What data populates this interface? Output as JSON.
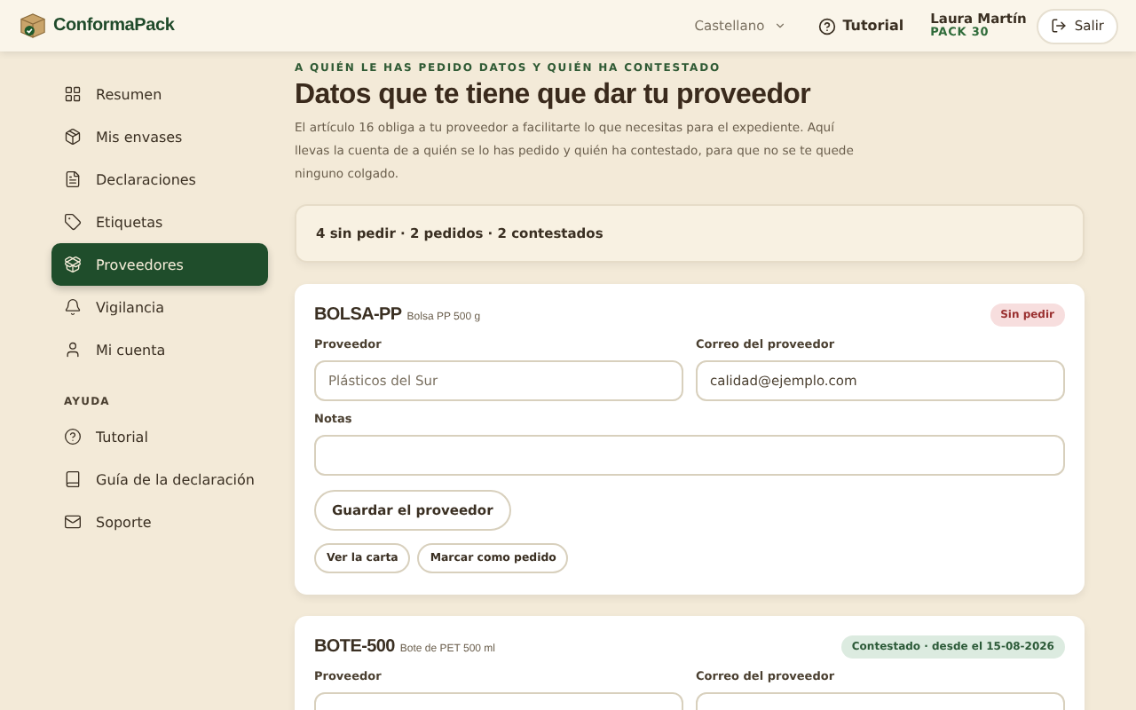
{
  "header": {
    "brand": "ConformaPack",
    "language": "Castellano",
    "tutorial": "Tutorial",
    "user": {
      "name": "Laura Martín",
      "plan": "PACK 30"
    },
    "logout": "Salir"
  },
  "sidebar": {
    "items": [
      {
        "label": "Resumen",
        "selected": false
      },
      {
        "label": "Mis envases",
        "selected": false
      },
      {
        "label": "Declaraciones",
        "selected": false
      },
      {
        "label": "Etiquetas",
        "selected": false
      },
      {
        "label": "Proveedores",
        "selected": true
      },
      {
        "label": "Vigilancia",
        "selected": false
      },
      {
        "label": "Mi cuenta",
        "selected": false
      }
    ],
    "section": "AYUDA",
    "help_items": [
      {
        "label": "Tutorial",
        "selected": false
      },
      {
        "label": "Guía de la declaración",
        "selected": false
      },
      {
        "label": "Soporte",
        "selected": false
      }
    ]
  },
  "main": {
    "eyebrow": "A QUIÉN LE HAS PEDIDO DATOS Y QUIÉN HA CONTESTADO",
    "title": "Datos que te tiene que dar tu proveedor",
    "intro": "El artículo 16 obliga a tu proveedor a facilitarte lo que necesitas para el expediente. Aquí llevas la cuenta de a quién se lo has pedido y quién ha contestado, para que no se te quede ninguno colgado.",
    "summary": "4 sin pedir · 2 pedidos · 2 contestados",
    "products": [
      {
        "code": "BOLSA-PP",
        "name": "Bolsa PP 500 g",
        "status": {
          "kind": "pending",
          "label": "Sin pedir"
        },
        "supplier_label": "Proveedor",
        "supplier": {
          "placeholder": "Plásticos del Sur"
        },
        "email_label": "Correo del proveedor",
        "email": {
          "value": "calidad@ejemplo.com"
        },
        "notes_label": "Notas",
        "save": "Guardar el proveedor",
        "actions": [
          "Ver la carta",
          "Marcar como pedido"
        ]
      },
      {
        "code": "BOTE-500",
        "name": "Bote de PET 500 ml",
        "status": {
          "kind": "answered",
          "label": "Contestado · desde el 15-08-2026"
        },
        "supplier_label": "Proveedor",
        "email_label": "Correo del proveedor"
      }
    ]
  }
}
